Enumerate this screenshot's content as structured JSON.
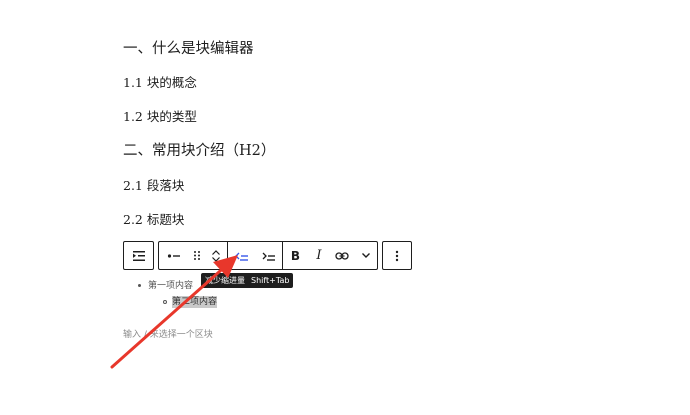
{
  "headings": [
    {
      "level": "h2",
      "text": "一、什么是块编辑器"
    },
    {
      "level": "h3",
      "text": "1.1 块的概念"
    },
    {
      "level": "h3",
      "text": "1.2 块的类型"
    },
    {
      "level": "h2",
      "text": "二、常用块介绍（H2）"
    },
    {
      "level": "h3",
      "text": "2.1 段落块"
    },
    {
      "level": "h3",
      "text": "2.2 标题块"
    }
  ],
  "toolbar": {
    "block_type_icon": "list-icon",
    "parent_icon": "list-bullet-icon",
    "drag_icon": "drag-handle-icon",
    "move_icons": [
      "chevron-up-icon",
      "chevron-down-icon"
    ],
    "outdent_icon": "outdent-icon",
    "indent_icon": "indent-icon",
    "bold_label": "B",
    "italic_label": "I",
    "link_icon": "link-icon",
    "more_formats_icon": "chevron-down-icon",
    "options_icon": "more-vertical-icon",
    "accent": "#3858e9"
  },
  "tooltip": {
    "label": "减少缩进量",
    "shortcut": "Shift+Tab"
  },
  "list": {
    "items": [
      {
        "text": "第一项内容",
        "nested": [
          {
            "text": "第二项内容"
          }
        ]
      }
    ]
  },
  "placeholder": "输入 / 来选择一个区块",
  "annotation": {
    "color": "#e8372b"
  }
}
